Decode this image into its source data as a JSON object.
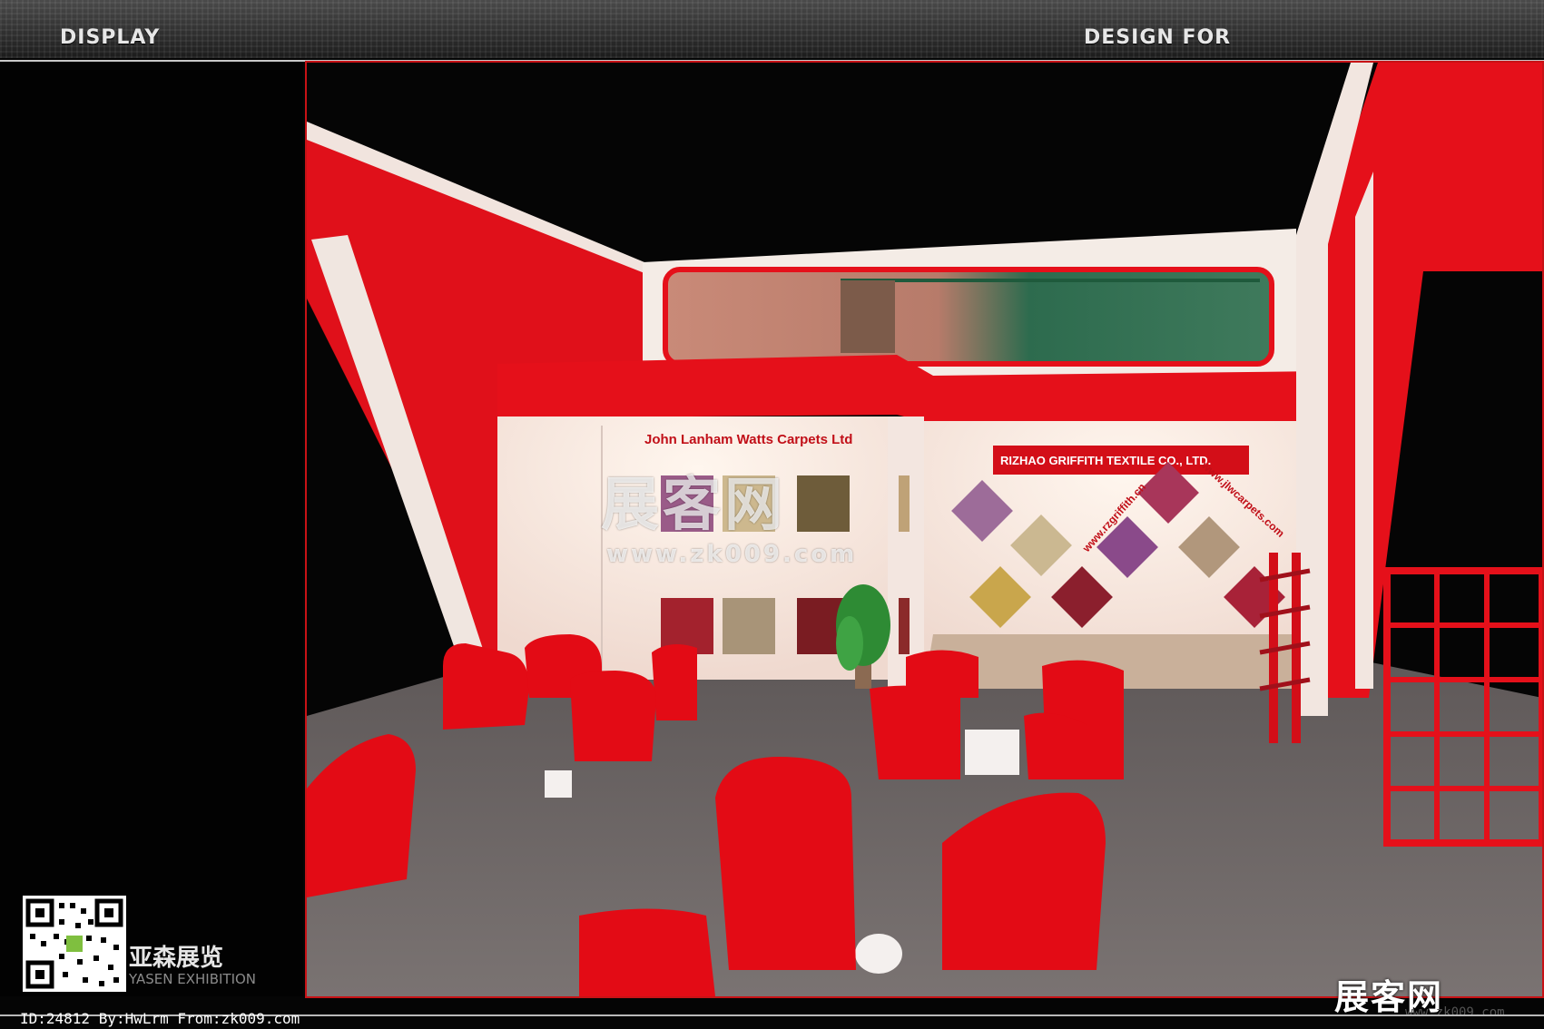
{
  "header": {
    "left_title": "DISPLAY",
    "right_title": "DESIGN FOR"
  },
  "booth": {
    "sign_left": "John Lanham Watts Carpets Ltd",
    "sign_right": "RIZHAO GRIFFITH TEXTILE CO., LTD.",
    "url_left": "www.rzgriffith.cn",
    "url_right": "www.jlwcarpets.com"
  },
  "watermarks": {
    "center_cn": "展客网",
    "center_url": "www.zk009.com",
    "corner_cn": "展客网",
    "corner_url": "www.zk009.com"
  },
  "footer": {
    "id_line": "ID:24812 By:HwLrm From:zk009.com",
    "brand_cn": "亚森展览",
    "brand_en": "YASEN EXHIBITION"
  },
  "colors": {
    "accent_red": "#e5101a",
    "wall_white": "#f3e9e2",
    "floor_grey": "#6b6564"
  }
}
